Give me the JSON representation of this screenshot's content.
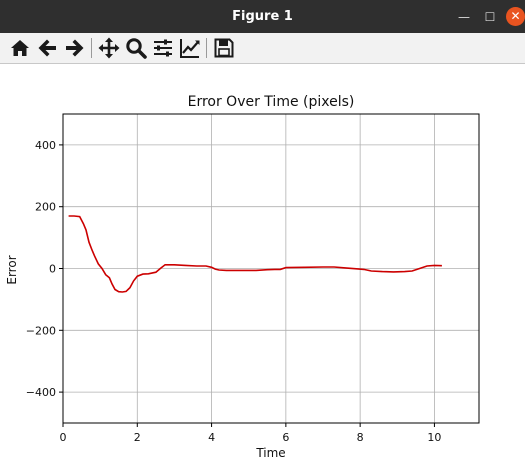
{
  "window": {
    "title": "Figure 1",
    "minimize_glyph": "—",
    "maximize_glyph": "☐",
    "close_glyph": "✕"
  },
  "toolbar": {
    "items": [
      {
        "name": "home-icon"
      },
      {
        "name": "back-arrow-icon"
      },
      {
        "name": "forward-arrow-icon"
      },
      {
        "name": "pan-icon"
      },
      {
        "name": "zoom-icon"
      },
      {
        "name": "configure-subplots-icon"
      },
      {
        "name": "edit-axes-icon"
      },
      {
        "name": "save-icon"
      }
    ]
  },
  "colors": {
    "line": "#cc0000",
    "grid": "#b0b0b0"
  },
  "chart_data": {
    "type": "line",
    "title": "Error Over Time (pixels)",
    "xlabel": "Time",
    "ylabel": "Error",
    "xlim": [
      0,
      11.2
    ],
    "ylim": [
      -500,
      500
    ],
    "xticks": [
      0,
      2,
      4,
      6,
      8,
      10
    ],
    "yticks": [
      -400,
      -200,
      0,
      200,
      400
    ],
    "xtick_labels": [
      "0",
      "2",
      "4",
      "6",
      "8",
      "10"
    ],
    "ytick_labels": [
      "−400",
      "−200",
      "0",
      "200",
      "400"
    ],
    "grid": true,
    "series": [
      {
        "x": [
          0.15,
          0.3,
          0.45,
          0.55,
          0.62,
          0.7,
          0.78,
          0.85,
          0.95,
          1.05,
          1.15,
          1.25,
          1.32,
          1.4,
          1.5,
          1.6,
          1.7,
          1.8,
          1.9,
          2.0,
          2.15,
          2.3,
          2.5,
          2.62,
          2.75,
          3.0,
          3.3,
          3.6,
          3.85,
          4.0,
          4.1,
          4.2,
          4.4,
          4.8,
          5.2,
          5.5,
          5.7,
          5.85,
          6.0,
          6.5,
          7.0,
          7.3,
          7.6,
          7.9,
          8.1,
          8.3,
          8.6,
          8.9,
          9.2,
          9.4,
          9.6,
          9.8,
          10.0,
          10.2
        ],
        "y": [
          170,
          170,
          168,
          145,
          125,
          85,
          60,
          40,
          15,
          0,
          -20,
          -30,
          -50,
          -68,
          -75,
          -76,
          -74,
          -62,
          -40,
          -25,
          -18,
          -17,
          -12,
          0,
          12,
          12,
          10,
          8,
          8,
          4,
          -2,
          -5,
          -6,
          -6,
          -6,
          -4,
          -3,
          -3,
          3,
          4,
          5,
          5,
          2,
          -1,
          -3,
          -8,
          -10,
          -11,
          -10,
          -8,
          0,
          8,
          10,
          9
        ]
      }
    ]
  }
}
